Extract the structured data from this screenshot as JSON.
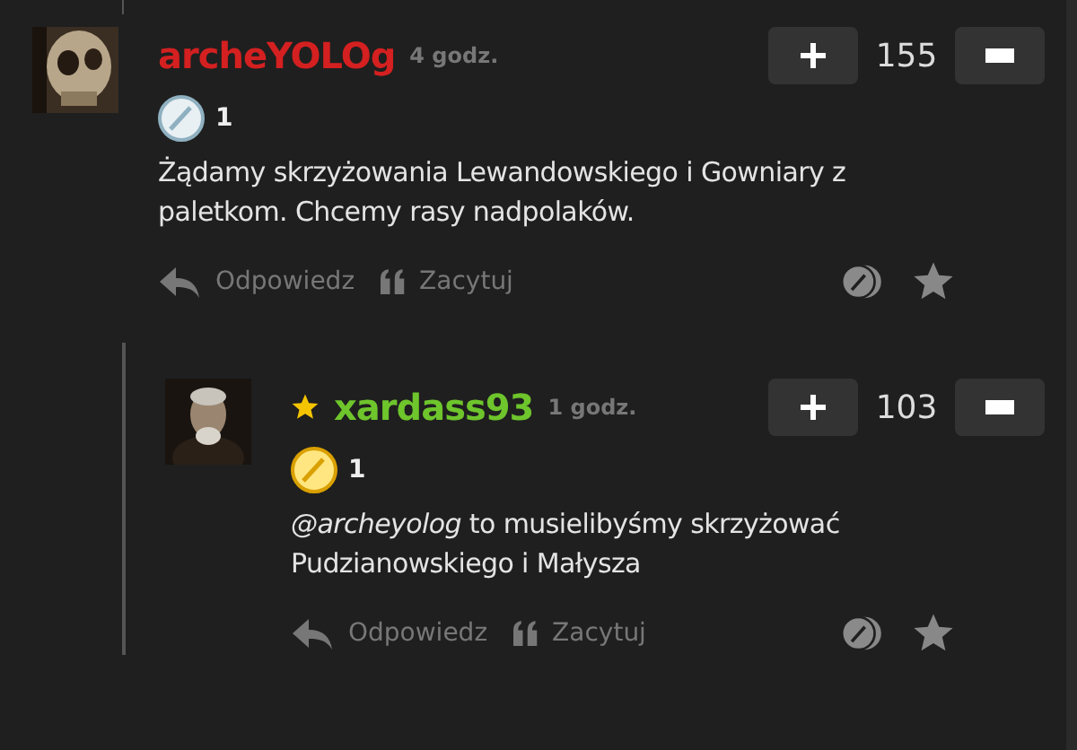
{
  "comments": [
    {
      "author": "archeYOLOg",
      "color": "#d42020",
      "starred": false,
      "time": "4 godz.",
      "score": "155",
      "badge": {
        "kind": "silver",
        "count": "1"
      },
      "text": "Żądamy skrzyżowania Lewandowskiego i Gowniary z paletkom. Chcemy rasy nadpolaków.",
      "actions": [
        "Odpowiedz",
        "Zacytuj"
      ]
    },
    {
      "author": "xardass93",
      "color": "#6ec52c",
      "starred": true,
      "time": "1 godz.",
      "score": "103",
      "badge": {
        "kind": "gold",
        "count": "1"
      },
      "text": "*@archeyolog* to musielibyśmy skrzyżować Pudzianowskiego i Małysza",
      "actions": [
        "Odpowiedz",
        "Zacytuj"
      ]
    }
  ]
}
